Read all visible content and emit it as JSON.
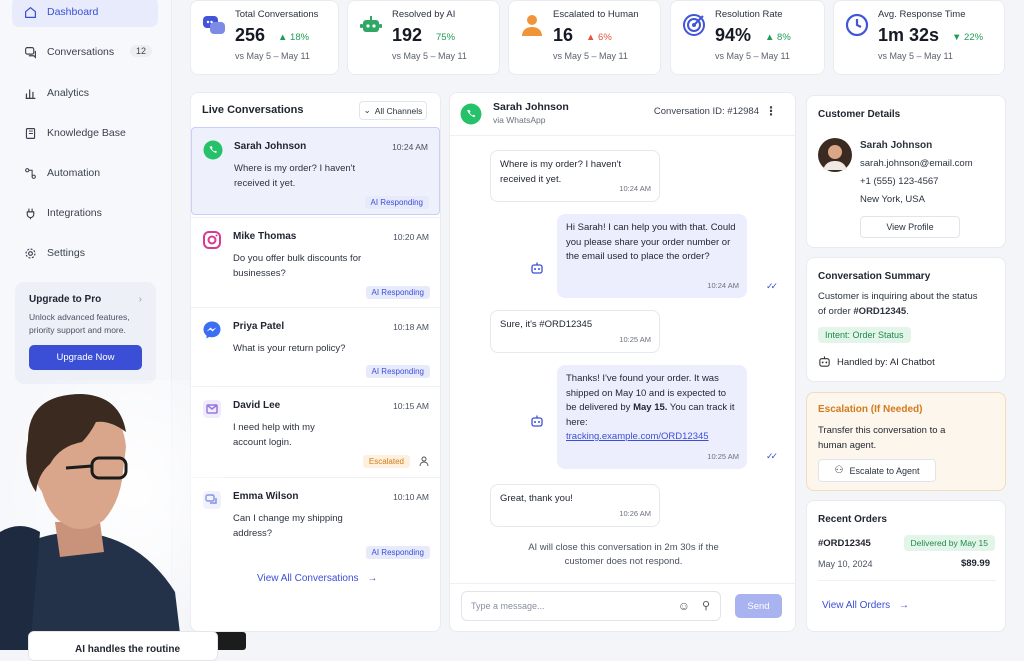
{
  "sidebar": {
    "items": [
      {
        "label": "Dashboard",
        "icon": "home-icon"
      },
      {
        "label": "Conversations",
        "icon": "chat-icon",
        "badge": "12"
      },
      {
        "label": "Analytics",
        "icon": "bar-chart-icon"
      },
      {
        "label": "Knowledge Base",
        "icon": "book-icon"
      },
      {
        "label": "Automation",
        "icon": "automation-icon"
      },
      {
        "label": "Integrations",
        "icon": "plug-icon"
      },
      {
        "label": "Settings",
        "icon": "gear-icon"
      }
    ],
    "upgrade": {
      "title": "Upgrade to Pro",
      "description": "Unlock advanced features, priority support and more.",
      "button": "Upgrade Now"
    }
  },
  "stats": [
    {
      "label": "Total Conversations",
      "value": "256",
      "delta": "18%",
      "direction": "up",
      "period": "vs May 5 – May 11"
    },
    {
      "label": "Resolved by AI",
      "value": "192",
      "delta": "75%",
      "direction": "none",
      "period": "vs May 5 – May 11"
    },
    {
      "label": "Escalated to Human",
      "value": "16",
      "delta": "6%",
      "direction": "up-bad",
      "period": "vs May 5 – May 11"
    },
    {
      "label": "Resolution Rate",
      "value": "94%",
      "delta": "8%",
      "direction": "up",
      "period": "vs May 5 – May 11"
    },
    {
      "label": "Avg. Response Time",
      "value": "1m 32s",
      "delta": "22%",
      "direction": "down-good",
      "period": "vs May 5 – May 11"
    }
  ],
  "live": {
    "title": "Live Conversations",
    "filter": "All Channels",
    "conversations": [
      {
        "name": "Sarah Johnson",
        "time": "10:24 AM",
        "message": "Where is my order? I haven't received it yet.",
        "status": "AI Responding",
        "channel": "whatsapp"
      },
      {
        "name": "Mike Thomas",
        "time": "10:20 AM",
        "message": "Do you offer bulk discounts for businesses?",
        "status": "AI Responding",
        "channel": "instagram"
      },
      {
        "name": "Priya Patel",
        "time": "10:18 AM",
        "message": "What is your return policy?",
        "status": "AI Responding",
        "channel": "messenger"
      },
      {
        "name": "David Lee",
        "time": "10:15 AM",
        "message": "I need help with my account login.",
        "status": "Escalated",
        "channel": "email"
      },
      {
        "name": "Emma Wilson",
        "time": "10:10 AM",
        "message": "Can I change my shipping address?",
        "status": "AI Responding",
        "channel": "chat"
      }
    ],
    "view_all": "View All Conversations"
  },
  "chat": {
    "name": "Sarah Johnson",
    "via": "via WhatsApp",
    "conversation_id": "Conversation ID: #12984",
    "messages": [
      {
        "from": "customer",
        "text": "Where is my order? I haven't received it yet.",
        "time": "10:24 AM"
      },
      {
        "from": "bot",
        "text": "Hi Sarah! I can help you with that. Could you please share your order number or the email used to place the order?",
        "time": "10:24 AM"
      },
      {
        "from": "customer",
        "text": "Sure, it's #ORD12345",
        "time": "10:25 AM"
      },
      {
        "from": "bot",
        "text_1": "Thanks! I've found your order.",
        "text_2": "It was shipped on May 10 and is expected to be delivered by",
        "text_bold": "May 15.",
        "text_3": "You can track it here:",
        "link": "tracking.example.com/ORD12345",
        "time": "10:25 AM"
      },
      {
        "from": "customer",
        "text": "Great, thank you!",
        "time": "10:26 AM"
      }
    ],
    "close_note": "AI will close this conversation in 2m 30s if the customer does not respond.",
    "input_placeholder": "Type a message...",
    "send": "Send"
  },
  "customer": {
    "title": "Customer Details",
    "name": "Sarah Johnson",
    "email": "sarah.johnson@email.com",
    "phone": "+1 (555) 123-4567",
    "location": "New York, USA",
    "view_profile": "View Profile"
  },
  "summary": {
    "title": "Conversation Summary",
    "text_1": "Customer is inquiring about the status of order",
    "order": "#ORD12345",
    "period": ".",
    "intent": "Intent: Order Status",
    "handled_by": "Handled by: AI Chatbot"
  },
  "escalation": {
    "title": "Escalation (If Needed)",
    "text": "Transfer this conversation to a human agent.",
    "button": "Escalate to Agent"
  },
  "orders": {
    "title": "Recent Orders",
    "id": "#ORD12345",
    "status": "Delivered by May 15",
    "date": "May 10, 2024",
    "amount": "$89.99",
    "view_all": "View All Orders"
  },
  "overlay": {
    "caption": "AI handles the routine"
  },
  "colors": {
    "accent": "#3b4fd6",
    "positive": "#1f9d55",
    "negative": "#e2553a",
    "warning": "#d27b1c"
  }
}
